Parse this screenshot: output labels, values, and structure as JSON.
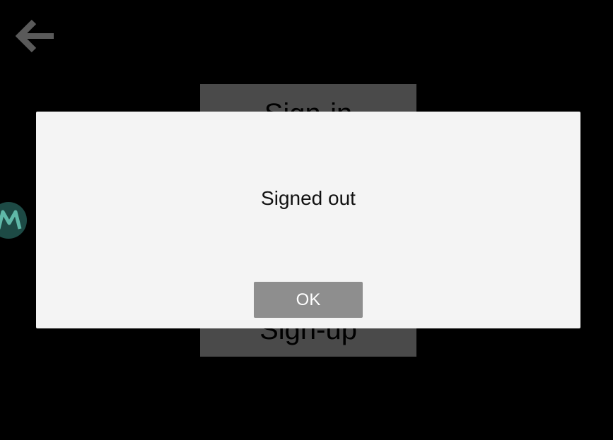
{
  "nav": {
    "back_icon": "arrow-left-icon",
    "back_color": "#5a5a5a"
  },
  "brand": {
    "logo_icon": "m-logo-icon",
    "logo_color": "#1d4a45"
  },
  "auth": {
    "signin_label": "Sign-in",
    "signup_label": "Sign-up",
    "button_color": "#4a4a4a"
  },
  "dialog": {
    "message": "Signed out",
    "ok_label": "OK",
    "background": "#f4f4f4",
    "ok_color": "#8e8e8e"
  }
}
